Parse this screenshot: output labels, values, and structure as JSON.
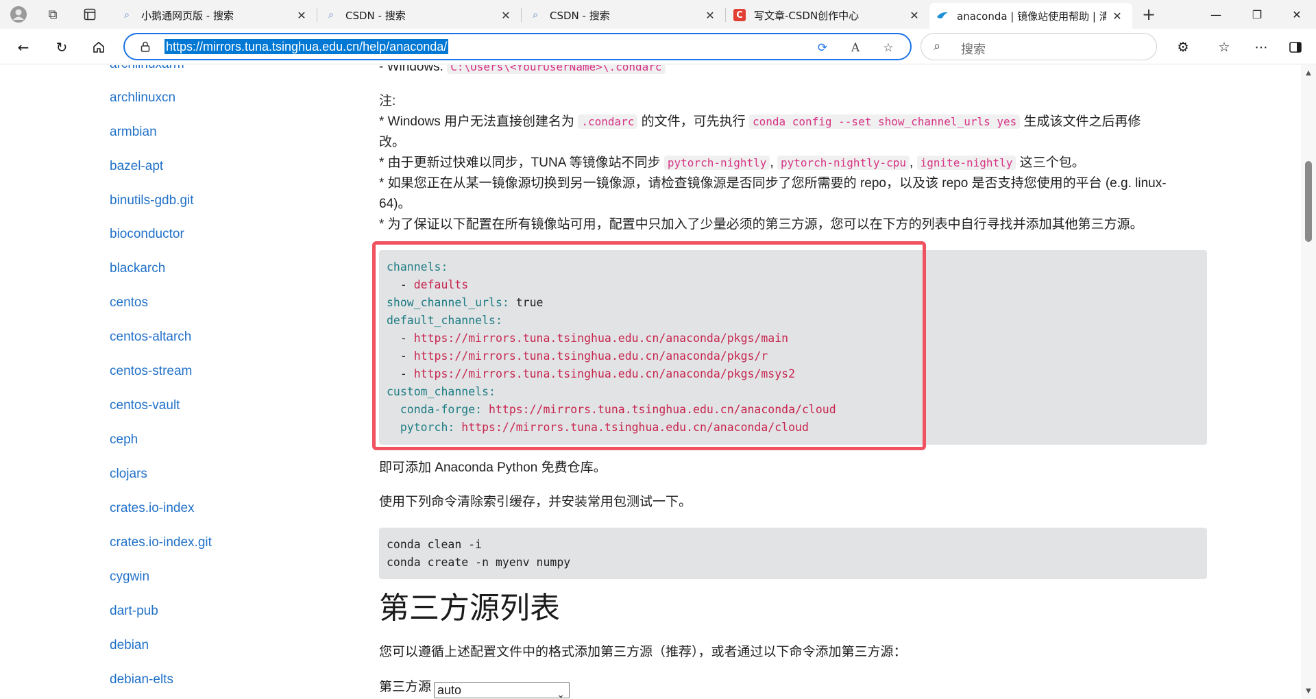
{
  "browser": {
    "tabs": [
      {
        "title": "小鹅通网页版 - 搜索",
        "icon": "search-icon",
        "active": false
      },
      {
        "title": "CSDN - 搜索",
        "icon": "search-icon",
        "active": false
      },
      {
        "title": "CSDN - 搜索",
        "icon": "search-icon",
        "active": false
      },
      {
        "title": "写文章-CSDN创作中心",
        "icon": "csdn-icon",
        "active": false
      },
      {
        "title": "anaconda | 镜像站使用帮助 | 清华",
        "icon": "tuna-icon",
        "active": true
      }
    ],
    "url": "https://mirrors.tuna.tsinghua.edu.cn/help/anaconda/",
    "search_placeholder": "搜索",
    "new_tab": "+",
    "window": {
      "minimize": "—",
      "restore": "❐",
      "close": "✕"
    }
  },
  "sidebar": {
    "items": [
      "archlinuxarm",
      "archlinuxcn",
      "armbian",
      "bazel-apt",
      "binutils-gdb.git",
      "bioconductor",
      "blackarch",
      "centos",
      "centos-altarch",
      "centos-stream",
      "centos-vault",
      "ceph",
      "clojars",
      "crates.io-index",
      "crates.io-index.git",
      "cygwin",
      "dart-pub",
      "debian",
      "debian-elts"
    ]
  },
  "content": {
    "windows_line_prefix": "- Windows: ",
    "windows_path": "C:\\Users\\<YourUserName>\\.condarc",
    "note_label": "注:",
    "note1_a": "* Windows 用户无法直接创建名为 ",
    "note1_code1": ".condarc",
    "note1_b": " 的文件，可先执行 ",
    "note1_code2": "conda config --set show_channel_urls yes",
    "note1_c": " 生成该文件之后再修",
    "note1_d": "改。",
    "note2_a": "* 由于更新过快难以同步，TUNA 等镜像站不同步 ",
    "note2_code1": "pytorch-nightly",
    "note2_code2": "pytorch-nightly-cpu",
    "note2_code3": "ignite-nightly",
    "note2_sep": ",",
    "note2_b": " 这三个包。",
    "note3_a": "* 如果您正在从某一镜像源切换到另一镜像源，请检查镜像源是否同步了您所需要的 repo，以及该 repo 是否支持您使用的平台 (e.g. linux-",
    "note3_b": "64)。",
    "note4": "* 为了保证以下配置在所有镜像站可用，配置中只加入了少量必须的第三方源，您可以在下方的列表中自行寻找并添加其他第三方源。",
    "config": {
      "channels_key": "channels:",
      "defaults_dash": "  - ",
      "defaults_val": "defaults",
      "show_key": "show_channel_urls:",
      "show_val": " true",
      "default_channels_key": "default_channels:",
      "dash": "  - ",
      "url_main": "https://mirrors.tuna.tsinghua.edu.cn/anaconda/pkgs/main",
      "url_r": "https://mirrors.tuna.tsinghua.edu.cn/anaconda/pkgs/r",
      "url_msys2": "https://mirrors.tuna.tsinghua.edu.cn/anaconda/pkgs/msys2",
      "custom_key": "custom_channels:",
      "condaforge_key": "  conda-forge:",
      "condaforge_val": " https://mirrors.tuna.tsinghua.edu.cn/anaconda/cloud",
      "pytorch_key": "  pytorch:",
      "pytorch_val": " https://mirrors.tuna.tsinghua.edu.cn/anaconda/cloud"
    },
    "after_config": "即可添加 Anaconda Python 免费仓库。",
    "clean_intro": "使用下列命令清除索引缓存，并安装常用包测试一下。",
    "cmd1": "conda clean -i",
    "cmd2": "conda create -n myenv numpy",
    "section_title": "第三方源列表",
    "section_desc": "您可以遵循上述配置文件中的格式添加第三方源（推荐），或者通过以下命令添加第三方源：",
    "source_label": "第三方源",
    "source_value": "auto"
  },
  "colors": {
    "link": "#2171c9",
    "highlight_border": "#f0525f",
    "code_bg": "#e2e3e5",
    "address_border": "#1a73e8"
  }
}
